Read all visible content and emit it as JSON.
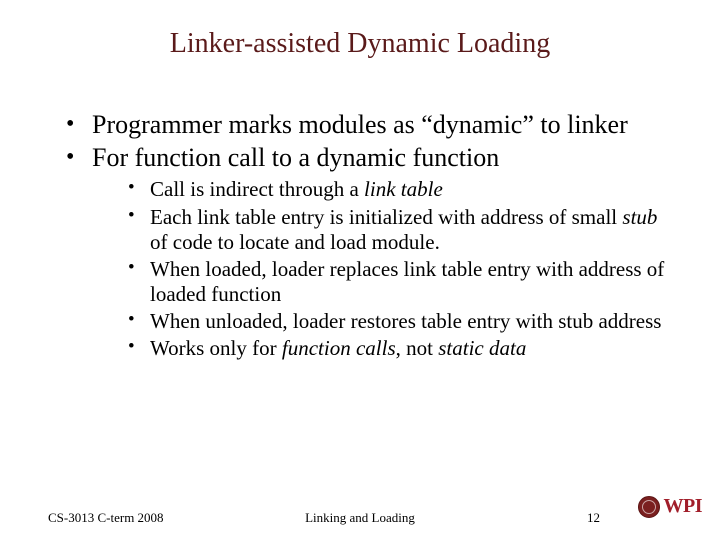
{
  "title": "Linker-assisted Dynamic Loading",
  "bullets": {
    "b1": "Programmer marks modules as “dynamic” to linker",
    "b2": "For function call to a dynamic function",
    "sub": {
      "s1a": "Call is indirect through a ",
      "s1b": "link table",
      "s2a": "Each link table entry is initialized with address of small ",
      "s2b": "stub",
      "s2c": " of code to locate and load module.",
      "s3": "When loaded, loader replaces link table entry with address of loaded function",
      "s4": "When unloaded, loader restores table entry with stub address",
      "s5a": "Works only for ",
      "s5b": "function calls",
      "s5c": ", not ",
      "s5d": "static data"
    }
  },
  "footer": {
    "left": "CS-3013 C-term 2008",
    "center": "Linking and Loading",
    "page": "12",
    "logo_text": "WPI"
  }
}
